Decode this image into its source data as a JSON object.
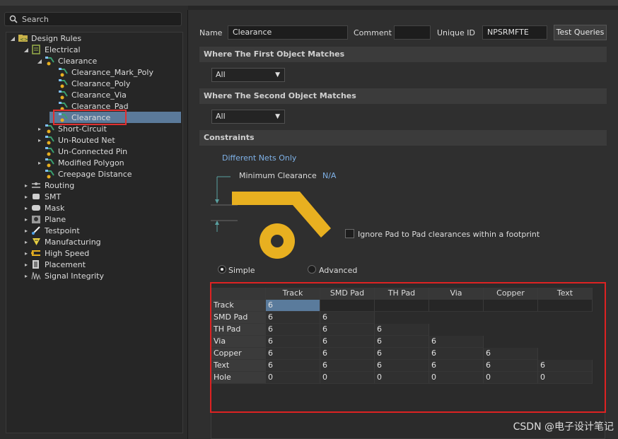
{
  "search": {
    "placeholder": "Search"
  },
  "tree": {
    "nodes": [
      {
        "label": "Design Rules",
        "icon": "design-rules-folder-icon"
      },
      {
        "label": "Electrical",
        "icon": "rule-category-icon"
      },
      {
        "label": "Clearance",
        "icon": "clearance-rule-icon"
      },
      {
        "label": "Clearance_Mark_Poly",
        "icon": "clearance-rule-icon"
      },
      {
        "label": "Clearance_Poly",
        "icon": "clearance-rule-icon"
      },
      {
        "label": "Clearance_Via",
        "icon": "clearance-rule-icon"
      },
      {
        "label": "Clearance_Pad",
        "icon": "clearance-rule-icon"
      },
      {
        "label": "Clearance",
        "icon": "clearance-rule-icon"
      },
      {
        "label": "Short-Circuit",
        "icon": "rule-icon"
      },
      {
        "label": "Un-Routed Net",
        "icon": "rule-icon"
      },
      {
        "label": "Un-Connected Pin",
        "icon": "rule-icon"
      },
      {
        "label": "Modified Polygon",
        "icon": "rule-icon"
      },
      {
        "label": "Creepage Distance",
        "icon": "rule-icon"
      },
      {
        "label": "Routing",
        "icon": "routing-icon"
      },
      {
        "label": "SMT",
        "icon": "smt-icon"
      },
      {
        "label": "Mask",
        "icon": "mask-icon"
      },
      {
        "label": "Plane",
        "icon": "plane-icon"
      },
      {
        "label": "Testpoint",
        "icon": "testpoint-icon"
      },
      {
        "label": "Manufacturing",
        "icon": "manufacturing-icon"
      },
      {
        "label": "High Speed",
        "icon": "high-speed-icon"
      },
      {
        "label": "Placement",
        "icon": "placement-icon"
      },
      {
        "label": "Signal Integrity",
        "icon": "signal-integrity-icon"
      }
    ]
  },
  "form": {
    "name_label": "Name",
    "name_value": "Clearance",
    "comment_label": "Comment",
    "comment_value": "",
    "uid_label": "Unique ID",
    "uid_value": "NPSRMFTE",
    "test_queries": "Test Queries"
  },
  "sections": {
    "first": "Where The First Object Matches",
    "second": "Where The Second Object Matches",
    "constraints": "Constraints"
  },
  "first_match": "All",
  "second_match": "All",
  "constraints": {
    "net_scope": "Different Nets Only",
    "min_clearance_label": "Minimum Clearance",
    "min_clearance_value": "N/A",
    "ignore_pad": "Ignore Pad to Pad clearances within a footprint",
    "mode_simple": "Simple",
    "mode_advanced": "Advanced",
    "mode_selected": "Simple",
    "illustration_color": "#e8b020"
  },
  "matrix": {
    "columns": [
      "Track",
      "SMD Pad",
      "TH Pad",
      "Via",
      "Copper",
      "Text"
    ],
    "rows": [
      {
        "label": "Track",
        "values": [
          "6"
        ]
      },
      {
        "label": "SMD Pad",
        "values": [
          "6",
          "6"
        ]
      },
      {
        "label": "TH Pad",
        "values": [
          "6",
          "6",
          "6"
        ]
      },
      {
        "label": "Via",
        "values": [
          "6",
          "6",
          "6",
          "6"
        ]
      },
      {
        "label": "Copper",
        "values": [
          "6",
          "6",
          "6",
          "6",
          "6"
        ]
      },
      {
        "label": "Text",
        "values": [
          "6",
          "6",
          "6",
          "6",
          "6",
          "6"
        ]
      },
      {
        "label": "Hole",
        "values": [
          "0",
          "0",
          "0",
          "0",
          "0",
          "0"
        ]
      }
    ]
  },
  "watermark": "CSDN @电子设计笔记",
  "colors": {
    "highlight": "#d22222",
    "selection": "#5b7a9a",
    "accent_text": "#7fb2e8"
  }
}
